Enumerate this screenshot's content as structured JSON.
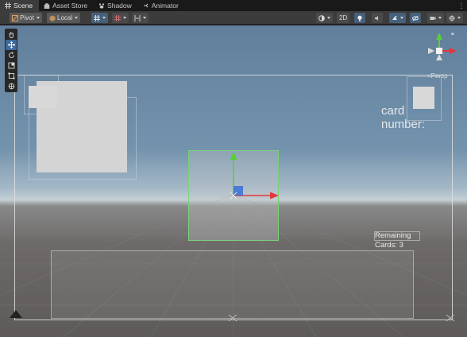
{
  "tabs": [
    {
      "label": "Scene",
      "icon": "grid-icon",
      "active": true
    },
    {
      "label": "Asset Store",
      "icon": "store-icon",
      "active": false
    },
    {
      "label": "Shadow",
      "icon": "paw-icon",
      "active": false
    },
    {
      "label": "Animator",
      "icon": "animator-icon",
      "active": false
    }
  ],
  "toolbar": {
    "pivot_label": "Pivot",
    "local_label": "Local",
    "mode_2d_label": "2D"
  },
  "scene": {
    "card_number_text": "card\nnumber:",
    "remaining_text": "Remaining\nCards: 3",
    "projection_label": "<Persp"
  },
  "colors": {
    "accent_blue": "#46607c",
    "selection_green": "#7ad27a",
    "axis_x": "#e0383b",
    "axis_y": "#5acd3c",
    "axis_z": "#3a6fd8"
  }
}
